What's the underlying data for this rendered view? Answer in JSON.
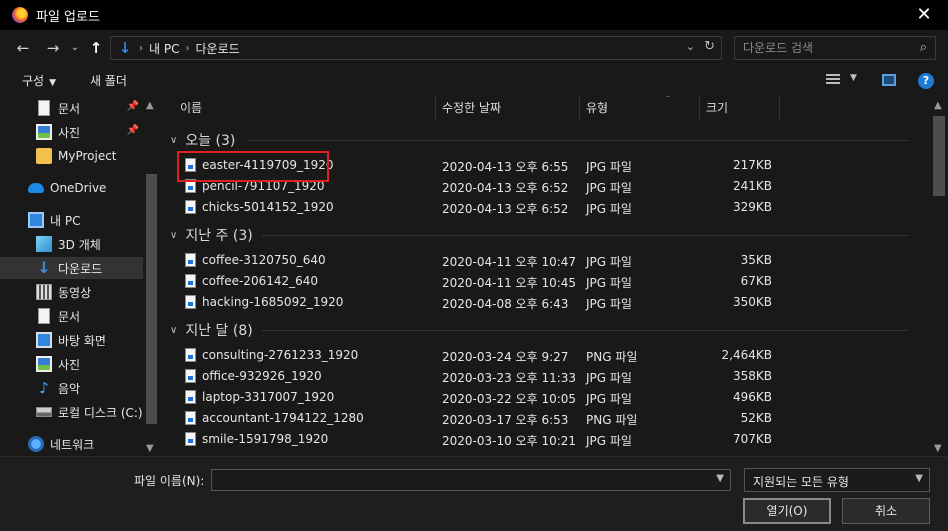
{
  "window": {
    "title": "파일 업로드",
    "close_glyph": "✕"
  },
  "nav": {
    "back": "←",
    "forward": "→",
    "recent": "⌄",
    "up": "↑"
  },
  "address": {
    "crumbs": [
      "내 PC",
      "다운로드"
    ],
    "separator": "›",
    "dropdown": "⌄",
    "refresh": "↻"
  },
  "search": {
    "placeholder": "다운로드 검색",
    "icon": "⌕"
  },
  "toolbar": {
    "organize": "구성",
    "new_folder": "새 폴더",
    "help": "?"
  },
  "sidebar": {
    "items": [
      {
        "label": "문서",
        "icon": "document-icon",
        "pinned": true
      },
      {
        "label": "사진",
        "icon": "pictures-icon",
        "pinned": true
      },
      {
        "label": "MyProject",
        "icon": "folder-icon",
        "pinned": false
      },
      {
        "label": "OneDrive",
        "icon": "onedrive-icon",
        "pinned": false
      },
      {
        "label": "내 PC",
        "icon": "pc-icon",
        "pinned": false
      },
      {
        "label": "3D 개체",
        "icon": "3d-objects-icon",
        "pinned": false
      },
      {
        "label": "다운로드",
        "icon": "downloads-icon",
        "pinned": false,
        "selected": true
      },
      {
        "label": "동영상",
        "icon": "videos-icon",
        "pinned": false
      },
      {
        "label": "문서",
        "icon": "document-icon",
        "pinned": false
      },
      {
        "label": "바탕 화면",
        "icon": "desktop-icon",
        "pinned": false
      },
      {
        "label": "사진",
        "icon": "pictures-icon",
        "pinned": false
      },
      {
        "label": "음악",
        "icon": "music-icon",
        "pinned": false
      },
      {
        "label": "로컬 디스크 (C:)",
        "icon": "drive-icon",
        "pinned": false
      },
      {
        "label": "네트워크",
        "icon": "network-icon",
        "pinned": false
      }
    ]
  },
  "columns": {
    "name": "이름",
    "date": "수정한 날짜",
    "type": "유형",
    "size": "크기"
  },
  "groups": [
    {
      "label": "오늘 (3)",
      "files": [
        {
          "name": "easter-4119709_1920",
          "date": "2020-04-13 오후 6:55",
          "type": "JPG 파일",
          "size": "217KB",
          "highlighted": true
        },
        {
          "name": "pencil-791107_1920",
          "date": "2020-04-13 오후 6:52",
          "type": "JPG 파일",
          "size": "241KB"
        },
        {
          "name": "chicks-5014152_1920",
          "date": "2020-04-13 오후 6:52",
          "type": "JPG 파일",
          "size": "329KB"
        }
      ]
    },
    {
      "label": "지난 주 (3)",
      "files": [
        {
          "name": "coffee-3120750_640",
          "date": "2020-04-11 오후 10:47",
          "type": "JPG 파일",
          "size": "35KB"
        },
        {
          "name": "coffee-206142_640",
          "date": "2020-04-11 오후 10:45",
          "type": "JPG 파일",
          "size": "67KB"
        },
        {
          "name": "hacking-1685092_1920",
          "date": "2020-04-08 오후 6:43",
          "type": "JPG 파일",
          "size": "350KB"
        }
      ]
    },
    {
      "label": "지난 달 (8)",
      "files": [
        {
          "name": "consulting-2761233_1920",
          "date": "2020-03-24 오후 9:27",
          "type": "PNG 파일",
          "size": "2,464KB"
        },
        {
          "name": "office-932926_1920",
          "date": "2020-03-23 오후 11:33",
          "type": "JPG 파일",
          "size": "358KB"
        },
        {
          "name": "laptop-3317007_1920",
          "date": "2020-03-22 오후 10:05",
          "type": "JPG 파일",
          "size": "496KB"
        },
        {
          "name": "accountant-1794122_1280",
          "date": "2020-03-17 오후 6:53",
          "type": "PNG 파일",
          "size": "52KB"
        },
        {
          "name": "smile-1591798_1920",
          "date": "2020-03-10 오후 10:21",
          "type": "JPG 파일",
          "size": "707KB"
        }
      ]
    }
  ],
  "bottom": {
    "filename_label": "파일 이름(N):",
    "filename_value": "",
    "filter_value": "지원되는 모든 유형",
    "open_label": "열기(O)",
    "cancel_label": "취소"
  },
  "colors": {
    "background": "#191919",
    "accent": "#2e86de",
    "highlight_box": "#e02020",
    "selected_item": "#333333"
  }
}
